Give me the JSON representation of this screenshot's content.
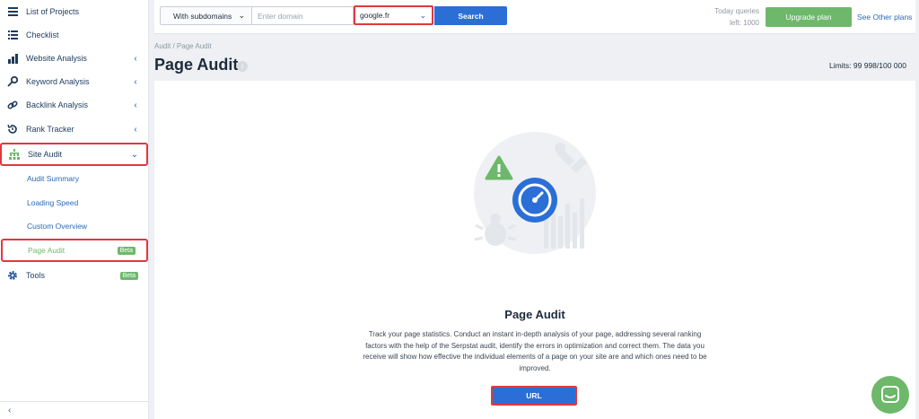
{
  "sidebar": {
    "items": [
      {
        "label": "List of Projects",
        "icon": "list-icon"
      },
      {
        "label": "Checklist",
        "icon": "checklist-icon"
      },
      {
        "label": "Website Analysis",
        "icon": "website-analysis-icon"
      },
      {
        "label": "Keyword Analysis",
        "icon": "key-icon"
      },
      {
        "label": "Backlink Analysis",
        "icon": "link-icon"
      },
      {
        "label": "Rank Tracker",
        "icon": "rank-tracker-icon"
      },
      {
        "label": "Site Audit",
        "icon": "site-audit-icon"
      }
    ],
    "sub_items": [
      "Audit Summary",
      "Loading Speed",
      "Custom Overview",
      "Page Audit"
    ],
    "page_audit_badge": "Beta",
    "tools": {
      "label": "Tools",
      "badge": "Beta",
      "icon": "gear-icon"
    }
  },
  "topbar": {
    "subdomains_select": "With subdomains",
    "domain_placeholder": "Enter domain",
    "search_engine": "google.fr",
    "search_label": "Search",
    "queries_line1": "Today queries",
    "queries_line2": "left: 1000",
    "upgrade_label": "Upgrade plan",
    "other_plans_label": "See Other plans"
  },
  "breadcrumb": "Audit / Page Audit",
  "page_title": "Page Audit",
  "limits": "Limits: 99 998/100 000",
  "card": {
    "title": "Page Audit",
    "description": "Track your page statistics. Conduct an instant in-depth analysis of your page, addressing several ranking factors with the help of the Serpstat audit, identify the errors in optimization and correct them. The data you receive will show how effective the individual elements of a page on your site are and which ones need to be improved.",
    "url_button": "URL"
  },
  "colors": {
    "accent_blue": "#2b6fd6",
    "green": "#6db86b",
    "highlight_red": "#e0393e"
  }
}
